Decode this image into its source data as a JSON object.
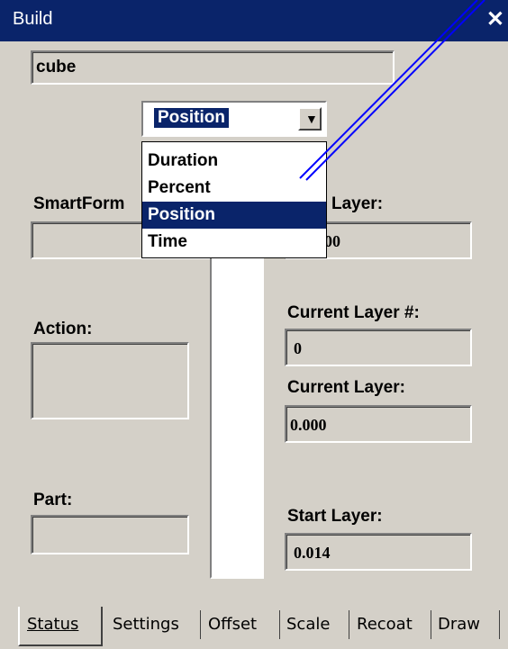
{
  "window": {
    "title": "Build",
    "close_glyph": "✕"
  },
  "name_field": {
    "value": "cube"
  },
  "combo": {
    "selected": "Position",
    "arrow": "▼"
  },
  "dropdown": {
    "options": [
      "Duration",
      "Percent",
      "Position",
      "Time"
    ],
    "selected_index": 2
  },
  "labels": {
    "smartform": "SmartForm",
    "layer_top": "Layer:",
    "action": "Action:",
    "current_layer_num": "Current Layer #:",
    "current_layer": "Current Layer:",
    "part": "Part:",
    "start_layer": "Start Layer:"
  },
  "values": {
    "layer_top_value": "00",
    "current_layer_num": "0",
    "current_layer": "0.000",
    "start_layer": "0.014"
  },
  "tabs": [
    "Status",
    "Settings",
    "Offset",
    "Scale",
    "Recoat",
    "Draw"
  ],
  "colors": {
    "titlebar": "#0a246a",
    "panel": "#d4d0c8",
    "selection": "#0a246a",
    "annotation_line": "#0000ff"
  }
}
